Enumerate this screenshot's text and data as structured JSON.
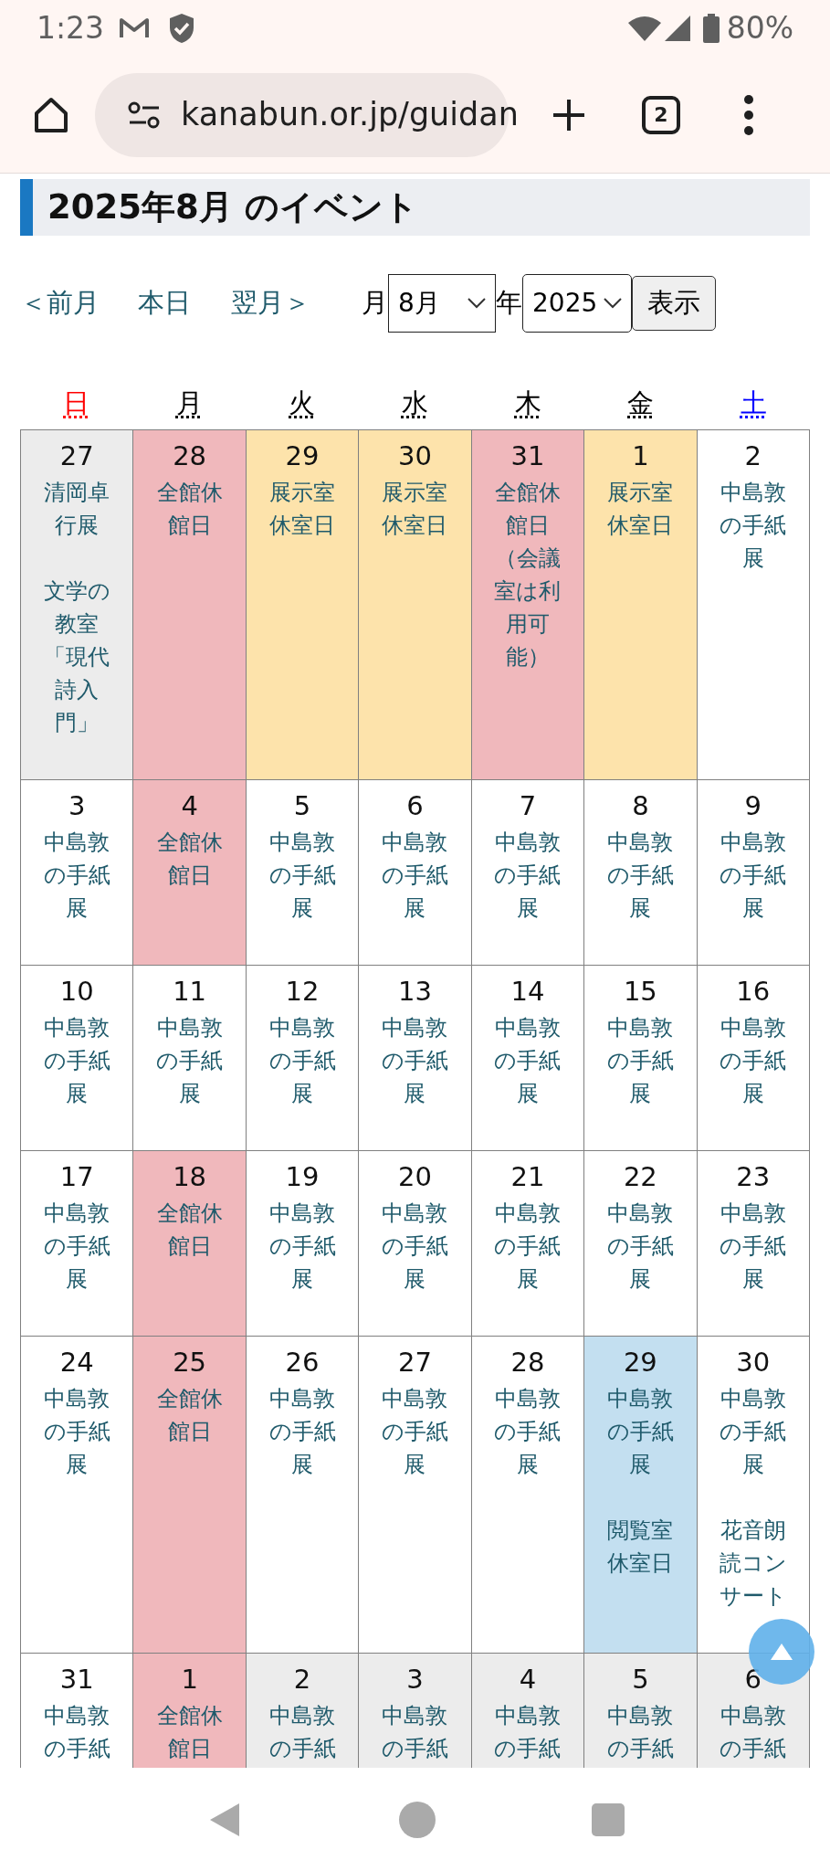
{
  "status_bar": {
    "time": "1:23",
    "battery": "80%"
  },
  "browser": {
    "url": "kanabun.or.jp/guidan",
    "tab_count": "2"
  },
  "heading": "2025年8月 のイベント",
  "nav": {
    "links": [
      "＜前月",
      "本日",
      "翌月＞"
    ],
    "month_label": "月",
    "month_value": "8月",
    "year_label": "年",
    "year_value": "2025",
    "submit": "表示"
  },
  "calendar": {
    "weekdays": [
      {
        "label": "日",
        "kind": "sunday"
      },
      {
        "label": "月",
        "kind": "weekday"
      },
      {
        "label": "火",
        "kind": "weekday"
      },
      {
        "label": "水",
        "kind": "weekday"
      },
      {
        "label": "木",
        "kind": "weekday"
      },
      {
        "label": "金",
        "kind": "weekday"
      },
      {
        "label": "土",
        "kind": "saturday"
      }
    ],
    "weeks": [
      {
        "days": [
          {
            "date": "27",
            "kind": "other_month",
            "events": [
              "清岡卓行展",
              "文学の教室「現代詩入門」"
            ]
          },
          {
            "date": "28",
            "kind": "closed",
            "events": [
              "全館休館日"
            ]
          },
          {
            "date": "29",
            "kind": "exhibit_closed",
            "events": [
              "展示室休室日"
            ]
          },
          {
            "date": "30",
            "kind": "exhibit_closed",
            "events": [
              "展示室休室日"
            ]
          },
          {
            "date": "31",
            "kind": "closed",
            "events": [
              "全館休館日（会議室は利用可能）"
            ]
          },
          {
            "date": "1",
            "kind": "exhibit_closed",
            "events": [
              "展示室休室日"
            ]
          },
          {
            "date": "2",
            "kind": "open",
            "events": [
              "中島敦の手紙展"
            ]
          }
        ]
      },
      {
        "days": [
          {
            "date": "3",
            "kind": "open",
            "events": [
              "中島敦の手紙展"
            ]
          },
          {
            "date": "4",
            "kind": "closed",
            "events": [
              "全館休館日"
            ]
          },
          {
            "date": "5",
            "kind": "open",
            "events": [
              "中島敦の手紙展"
            ]
          },
          {
            "date": "6",
            "kind": "open",
            "events": [
              "中島敦の手紙展"
            ]
          },
          {
            "date": "7",
            "kind": "open",
            "events": [
              "中島敦の手紙展"
            ]
          },
          {
            "date": "8",
            "kind": "open",
            "events": [
              "中島敦の手紙展"
            ]
          },
          {
            "date": "9",
            "kind": "open",
            "events": [
              "中島敦の手紙展"
            ]
          }
        ]
      },
      {
        "days": [
          {
            "date": "10",
            "kind": "open",
            "events": [
              "中島敦の手紙展"
            ]
          },
          {
            "date": "11",
            "kind": "open",
            "events": [
              "中島敦の手紙展"
            ]
          },
          {
            "date": "12",
            "kind": "open",
            "events": [
              "中島敦の手紙展"
            ]
          },
          {
            "date": "13",
            "kind": "open",
            "events": [
              "中島敦の手紙展"
            ]
          },
          {
            "date": "14",
            "kind": "open",
            "events": [
              "中島敦の手紙展"
            ]
          },
          {
            "date": "15",
            "kind": "open",
            "events": [
              "中島敦の手紙展"
            ]
          },
          {
            "date": "16",
            "kind": "open",
            "events": [
              "中島敦の手紙展"
            ]
          }
        ]
      },
      {
        "days": [
          {
            "date": "17",
            "kind": "open",
            "events": [
              "中島敦の手紙展"
            ]
          },
          {
            "date": "18",
            "kind": "closed",
            "events": [
              "全館休館日"
            ]
          },
          {
            "date": "19",
            "kind": "open",
            "events": [
              "中島敦の手紙展"
            ]
          },
          {
            "date": "20",
            "kind": "open",
            "events": [
              "中島敦の手紙展"
            ]
          },
          {
            "date": "21",
            "kind": "open",
            "events": [
              "中島敦の手紙展"
            ]
          },
          {
            "date": "22",
            "kind": "open",
            "events": [
              "中島敦の手紙展"
            ]
          },
          {
            "date": "23",
            "kind": "open",
            "events": [
              "中島敦の手紙展"
            ]
          }
        ]
      },
      {
        "days": [
          {
            "date": "24",
            "kind": "open",
            "events": [
              "中島敦の手紙展"
            ]
          },
          {
            "date": "25",
            "kind": "closed",
            "events": [
              "全館休館日"
            ]
          },
          {
            "date": "26",
            "kind": "open",
            "events": [
              "中島敦の手紙展"
            ]
          },
          {
            "date": "27",
            "kind": "open",
            "events": [
              "中島敦の手紙展"
            ]
          },
          {
            "date": "28",
            "kind": "open",
            "events": [
              "中島敦の手紙展"
            ]
          },
          {
            "date": "29",
            "kind": "reading_closed",
            "events": [
              "中島敦の手紙展",
              "閲覧室休室日"
            ]
          },
          {
            "date": "30",
            "kind": "open",
            "events": [
              "中島敦の手紙展",
              "花音朗読コンサート"
            ]
          }
        ]
      },
      {
        "days": [
          {
            "date": "31",
            "kind": "open",
            "events": [
              "中島敦の手紙"
            ]
          },
          {
            "date": "1",
            "kind": "closed",
            "events": [
              "全館休館日"
            ]
          },
          {
            "date": "2",
            "kind": "other_month",
            "events": [
              "中島敦の手紙"
            ]
          },
          {
            "date": "3",
            "kind": "other_month",
            "events": [
              "中島敦の手紙"
            ]
          },
          {
            "date": "4",
            "kind": "other_month",
            "events": [
              "中島敦の手紙"
            ]
          },
          {
            "date": "5",
            "kind": "other_month",
            "events": [
              "中島敦の手紙"
            ]
          },
          {
            "date": "6",
            "kind": "other_month",
            "events": [
              "中島敦の手紙"
            ]
          }
        ]
      }
    ]
  }
}
